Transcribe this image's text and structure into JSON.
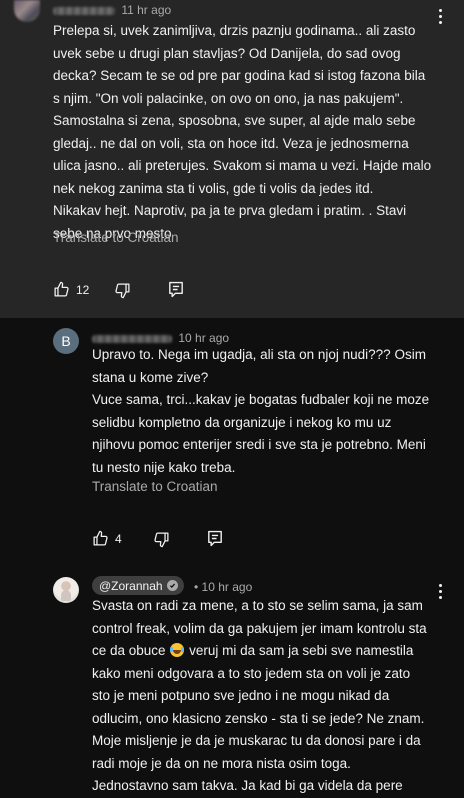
{
  "comments": [
    {
      "timestamp": "11 hr ago",
      "text": [
        "Prelepa si, uvek zanimljiva, drzis paznju godinama.. ali zasto",
        "uvek sebe u drugi plan stavljas? Od Danijela, do sad ovog",
        "decka? Secam te se od pre par godina kad si istog fazona bila",
        "s njim. \"On voli palacinke, on ovo on ono, ja nas pakujem\".",
        "Samostalna si zena, sposobna, sve super, al ajde malo sebe",
        "gledaj.. ne dal on voli, sta on hoce itd. Veza je jednosmerna",
        "ulica jasno.. ali preterujes. Svakom si mama u vezi. Hajde malo",
        "nek nekog zanima sta ti volis, gde ti volis da jedes itd.",
        "Nikakav hejt. Naprotiv, pa ja te prva gledam i pratim. . Stavi",
        "sebe na prvo mesto"
      ],
      "translate_label": "Translate to Croatian",
      "like_count": "12"
    },
    {
      "avatar_letter": "B",
      "timestamp": "10 hr ago",
      "text": [
        "Upravo to. Nega im ugadja, ali sta on njoj nudi??? Osim",
        "stana u kome zive?",
        "Vuce sama, trci...kakav je bogatas fudbaler koji ne moze",
        "selidbu kompletno da organizuje i nekog ko mu uz",
        "njihovu pomoc enterijer sredi i sve sta je potrebno. Meni",
        "tu nesto nije kako treba."
      ],
      "translate_label": "Translate to Croatian",
      "like_count": "4"
    },
    {
      "handle": "@Zorannah",
      "timestamp": "10 hr ago",
      "text_line1": "Svasta on radi za mene, a to sto se selim sama, ja sam",
      "text_line2a": "control freak, volim da ga pakujem jer imam kontrolu sta",
      "text_line3a": "ce da obuce",
      "text_line3b": " veruj mi da sam ja sebi sve namestila",
      "text_rest": [
        "kako meni odgovara a to sto jedem sta on voli je zato",
        "sto je meni potpuno sve jedno i ne mogu nikad da",
        "odlucim, ono klasicno zensko - sta ti se jede? Ne znam.",
        "Moje misljenje je da je muskarac tu da donosi pare i da",
        "radi moje je da on ne mora nista osim toga.",
        "Jednostavno sam takva. Ja kad bi ga videla da pere"
      ]
    }
  ]
}
